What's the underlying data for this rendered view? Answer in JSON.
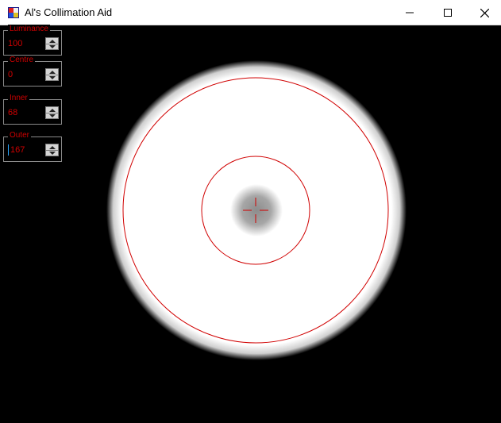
{
  "window": {
    "title": "Al's Collimation Aid",
    "icons": {
      "app": "app-icon",
      "minimize": "minimize-icon",
      "maximize": "maximize-icon",
      "close": "close-icon"
    }
  },
  "controls": [
    {
      "id": "luminance",
      "label": "Luminance",
      "value": "100"
    },
    {
      "id": "centre",
      "label": "Centre",
      "value": "0"
    },
    {
      "id": "inner",
      "label": "Inner",
      "value": "68"
    },
    {
      "id": "outer",
      "label": "Outer",
      "value": "167"
    }
  ],
  "colors": {
    "background": "#000000",
    "label": "#d00000",
    "overlay_lines": "#d00000",
    "disc": "#ffffff",
    "focus_caret": "#2aa8ff"
  }
}
